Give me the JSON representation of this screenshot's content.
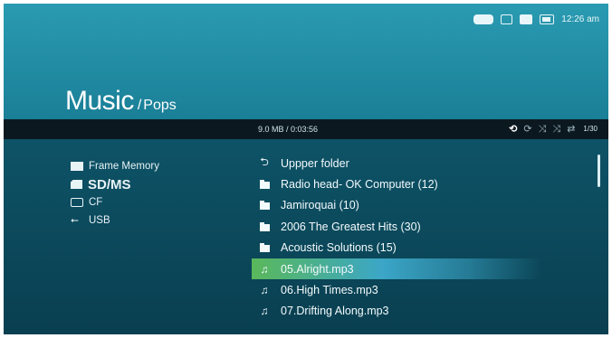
{
  "status": {
    "time": "12:26 am",
    "icons": [
      "connection-icon",
      "card-icon",
      "sd-card-icon",
      "battery-icon"
    ]
  },
  "header": {
    "title": "Music",
    "separator": "/",
    "subtitle": "Pops"
  },
  "info": {
    "details": "9.0 MB / 0:03:56",
    "track_count": "1/30"
  },
  "playback_icons": [
    "repeat-all-icon",
    "repeat-one-icon",
    "shuffle-icon",
    "shuffle-off-icon",
    "repeat-off-icon"
  ],
  "sources": [
    {
      "label": "Frame Memory",
      "icon": "frame-memory-icon"
    },
    {
      "label": "SD/MS",
      "icon": "sd-card-icon",
      "selected": true
    },
    {
      "label": "CF",
      "icon": "cf-card-icon"
    },
    {
      "label": "USB",
      "icon": "usb-icon"
    }
  ],
  "files": [
    {
      "label": "Uppper folder",
      "icon": "upper-folder-icon"
    },
    {
      "label": "Radio head- OK Computer (12)",
      "icon": "folder-icon"
    },
    {
      "label": "Jamiroquai (10)",
      "icon": "folder-icon"
    },
    {
      "label": "2006 The Greatest Hits (30)",
      "icon": "folder-icon"
    },
    {
      "label": "Acoustic Solutions (15)",
      "icon": "folder-icon"
    },
    {
      "label": "05.Alright.mp3",
      "icon": "music-note-icon",
      "highlighted": true
    },
    {
      "label": "06.High Times.mp3",
      "icon": "music-note-icon"
    },
    {
      "label": "07.Drifting Along.mp3",
      "icon": "music-note-icon"
    }
  ],
  "colors": {
    "header": "#1f8aa3",
    "background": "#0b4c5f",
    "info_bar": "#0c1820",
    "highlight_start": "#5ab85a",
    "highlight_end": "#3ba6c7"
  }
}
